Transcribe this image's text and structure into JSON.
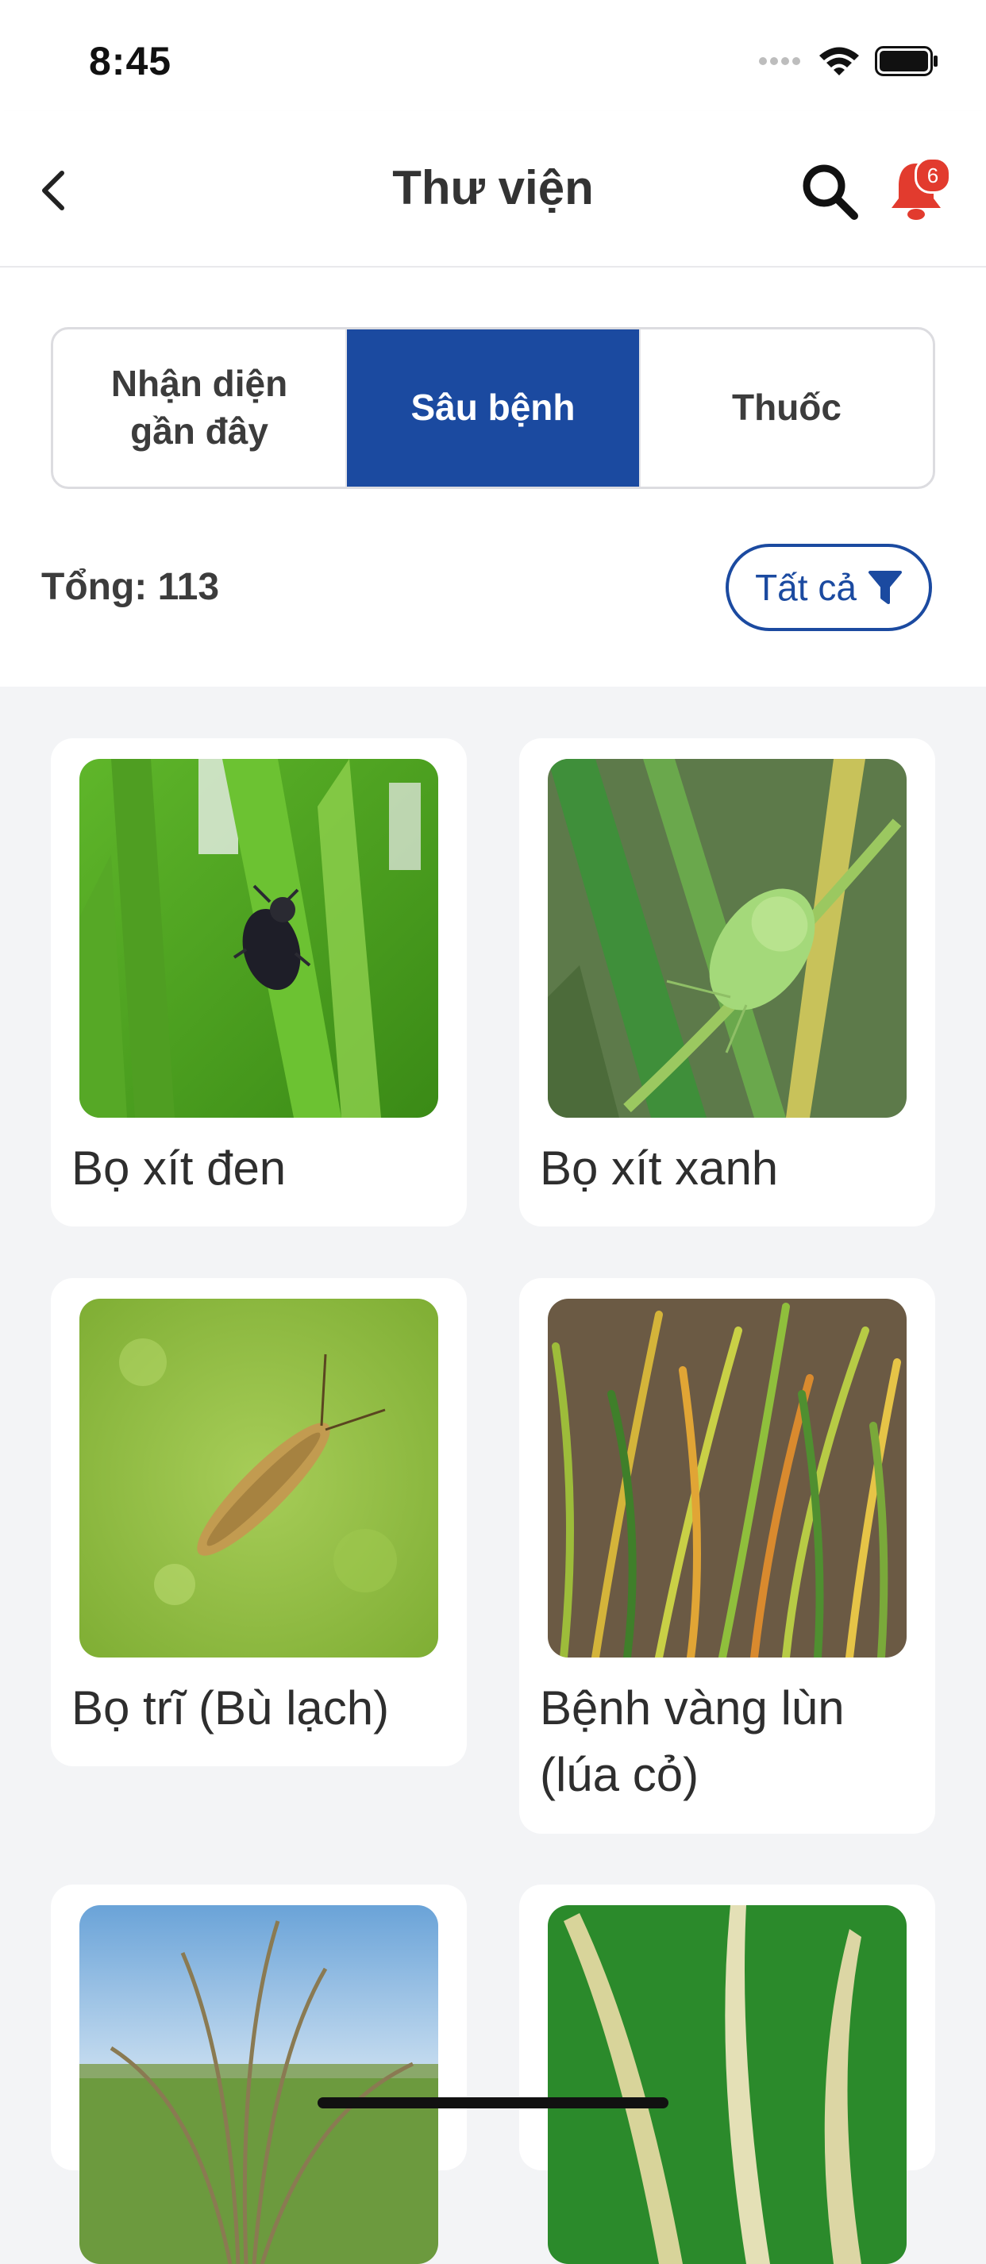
{
  "status_bar": {
    "time": "8:45"
  },
  "header": {
    "title": "Thư viện",
    "notification_count": "6"
  },
  "tabs": [
    {
      "label": "Nhận diện\ngần đây",
      "active": false
    },
    {
      "label": "Sâu bệnh",
      "active": true
    },
    {
      "label": "Thuốc",
      "active": false
    }
  ],
  "summary": {
    "total_label": "Tổng: 113"
  },
  "filter": {
    "label": "Tất cả"
  },
  "items": [
    {
      "name": "Bọ xít đen",
      "image": "black-stink-bug-on-rice-leaf"
    },
    {
      "name": "Bọ xít xanh",
      "image": "green-stink-bug-on-rice-stem"
    },
    {
      "name": "Bọ trĩ (Bù lạch)",
      "image": "thrips-macro-photo"
    },
    {
      "name": "Bệnh vàng lùn (lúa cỏ)",
      "image": "yellow-dwarf-rice-plants"
    },
    {
      "name": "",
      "image": "dried-rice-tuft-field"
    },
    {
      "name": "",
      "image": "pale-rice-leaves-green-bg"
    }
  ],
  "colors": {
    "primary": "#1b4aa0",
    "badge": "#e23b2e",
    "bell": "#e23b2e",
    "background": "#f3f4f6"
  }
}
